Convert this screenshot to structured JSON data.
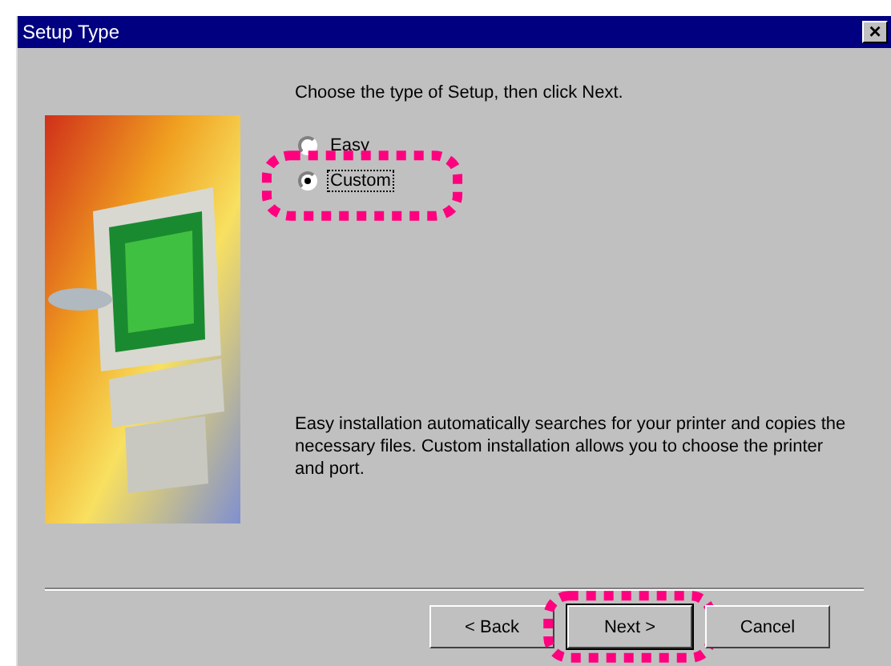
{
  "window": {
    "title": "Setup Type",
    "close": "×"
  },
  "prompt": "Choose the type of Setup, then click Next.",
  "options": [
    {
      "label": "Easy",
      "selected": false,
      "focused": false,
      "highlighted": false
    },
    {
      "label": "Custom",
      "selected": true,
      "focused": true,
      "highlighted": true
    }
  ],
  "description": "Easy installation automatically searches for your printer and copies the necessary files. Custom installation allows you to choose the printer and port.",
  "buttons": [
    {
      "label": "< Back",
      "default": false,
      "highlighted": false
    },
    {
      "label": "Next >",
      "default": true,
      "highlighted": true
    },
    {
      "label": "Cancel",
      "default": false,
      "highlighted": false
    }
  ]
}
